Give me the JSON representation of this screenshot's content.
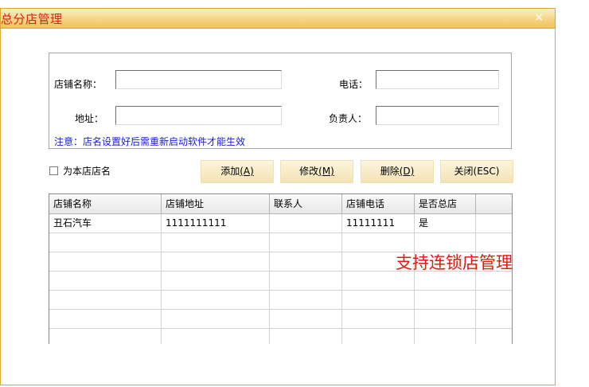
{
  "window": {
    "title": "总分店管理",
    "close_glyph": "×"
  },
  "form": {
    "store_name_label": "店铺名称：",
    "store_name_value": "",
    "phone_label": "电话：",
    "phone_value": "",
    "address_label": "地址：",
    "address_value": "",
    "manager_label": "负责人：",
    "manager_value": "",
    "notice": "注意：店名设置好后需重新启动软件才能生效"
  },
  "checkbox": {
    "label": "为本店店名",
    "checked": false
  },
  "buttons": {
    "add_label": "添加",
    "add_hotkey": "(A)",
    "edit_label": "修改",
    "edit_hotkey": "(M)",
    "delete_label": "删除",
    "delete_hotkey": "(D)",
    "close_label": "关闭(ESC)"
  },
  "table": {
    "columns": [
      "店铺名称",
      "店铺地址",
      "联系人",
      "店铺电话",
      "是否总店"
    ],
    "rows": [
      [
        "丑石汽车",
        "1111111111",
        "",
        "11111111",
        "是"
      ],
      [
        "",
        "",
        "",
        "",
        ""
      ],
      [
        "",
        "",
        "",
        "",
        ""
      ],
      [
        "",
        "",
        "",
        "",
        ""
      ],
      [
        "",
        "",
        "",
        "",
        ""
      ],
      [
        "",
        "",
        "",
        "",
        ""
      ],
      [
        "",
        "",
        "",
        "",
        ""
      ]
    ]
  },
  "overlay_text": "支持连锁店管理",
  "colors": {
    "accent": "#e0a436",
    "title_text": "#d8201a",
    "notice": "#1a20d6",
    "overlay": "#e01a12"
  }
}
